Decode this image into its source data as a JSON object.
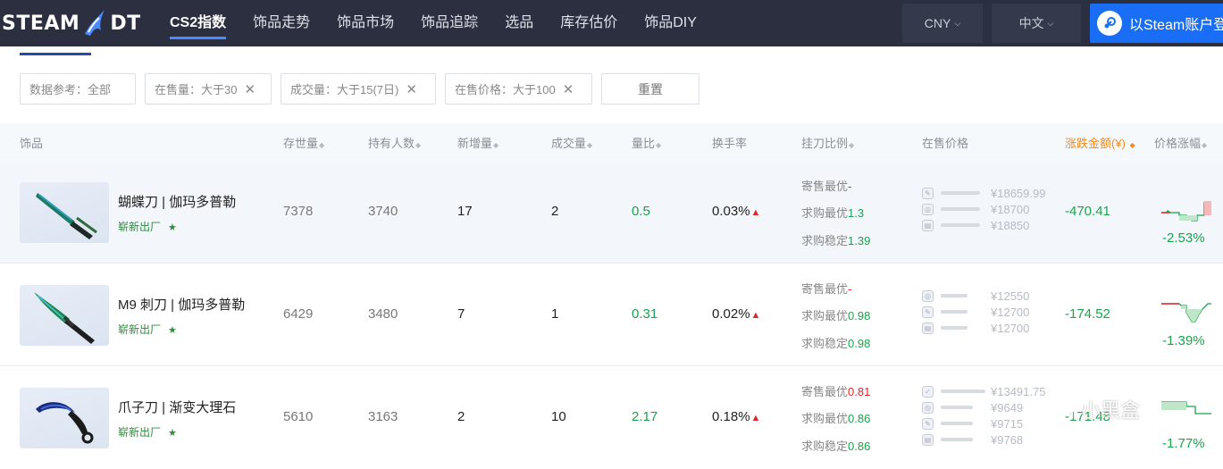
{
  "header": {
    "logo_left": "STEAM",
    "logo_right": "DT",
    "nav": [
      {
        "label": "CS2指数",
        "active": true
      },
      {
        "label": "饰品走势",
        "active": false
      },
      {
        "label": "饰品市场",
        "active": false
      },
      {
        "label": "饰品追踪",
        "active": false
      },
      {
        "label": "选品",
        "active": false
      },
      {
        "label": "库存估价",
        "active": false
      },
      {
        "label": "饰品DIY",
        "active": false
      }
    ],
    "currency": "CNY",
    "language": "中文",
    "login_label": "以Steam账户登"
  },
  "filters": {
    "data_ref": "数据参考：全部",
    "on_sale": "在售量：大于30",
    "volume": "成交量：大于15(7日)",
    "price": "在售价格：大于100",
    "reset": "重置"
  },
  "columns": {
    "item": "饰品",
    "supply": "存世量",
    "holders": "持有人数",
    "new_add": "新增量",
    "deals": "成交量",
    "qty_ratio": "量比",
    "turnover": "换手率",
    "knife_ratio": "挂刀比例",
    "on_sale_price": "在售价格",
    "change_amount": "涨跌金额(¥)",
    "change_pct": "价格涨幅"
  },
  "rows": [
    {
      "name": "蝴蝶刀 | 伽玛多普勒",
      "wear": "崭新出厂",
      "star": "★",
      "supply": "7378",
      "holders": "3740",
      "new_add": "17",
      "deals": "2",
      "qty_ratio": "0.5",
      "turnover": "0.03%",
      "ratio_labels": [
        "寄售最优",
        "求购最优",
        "求购稳定"
      ],
      "ratio_values": [
        "-",
        "1.3",
        "1.39"
      ],
      "prices": [
        "¥18659.99",
        "¥18700",
        "¥18850"
      ],
      "change_amount": "-470.41",
      "change_pct": "-2.53%"
    },
    {
      "name": "M9 刺刀 | 伽玛多普勒",
      "wear": "崭新出厂",
      "star": "★",
      "supply": "6429",
      "holders": "3480",
      "new_add": "7",
      "deals": "1",
      "qty_ratio": "0.31",
      "turnover": "0.02%",
      "ratio_labels": [
        "寄售最优",
        "求购最优",
        "求购稳定"
      ],
      "ratio_values": [
        "-",
        "0.98",
        "0.98"
      ],
      "prices": [
        "¥12550",
        "¥12700",
        "¥12700"
      ],
      "change_amount": "-174.52",
      "change_pct": "-1.39%"
    },
    {
      "name": "爪子刀 | 渐变大理石",
      "wear": "崭新出厂",
      "star": "★",
      "supply": "5610",
      "holders": "3163",
      "new_add": "2",
      "deals": "10",
      "qty_ratio": "2.17",
      "turnover": "0.18%",
      "ratio_labels": [
        "寄售最优",
        "求购最优",
        "求购稳定"
      ],
      "ratio_values": [
        "0.81",
        "0.86",
        "0.86"
      ],
      "prices": [
        "¥13491.75",
        "¥9649",
        "¥9715",
        "¥9768"
      ],
      "change_amount": "-171.48",
      "change_pct": "-1.77%"
    }
  ],
  "watermark": "小黑盒",
  "colors": {
    "header_bg": "#2b2f3f",
    "accent_blue": "#1a6ef5",
    "up_green": "#1aa34a",
    "red": "#e1252b",
    "orange": "#f08a24"
  }
}
